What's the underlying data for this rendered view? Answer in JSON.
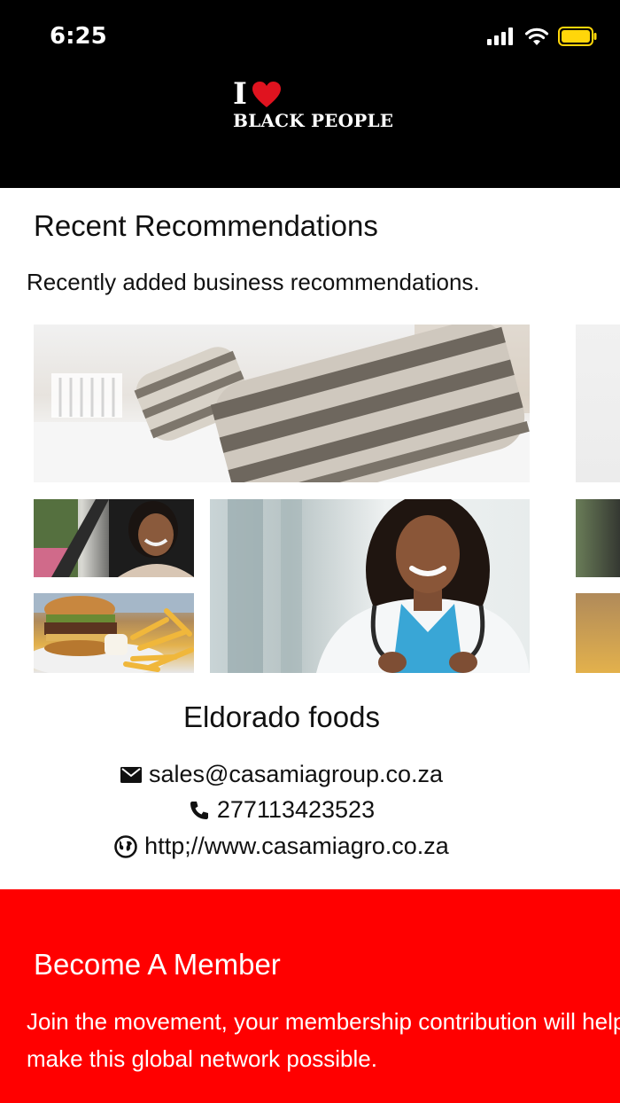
{
  "status_bar": {
    "time": "6:25",
    "icons": [
      "signal-icon",
      "wifi-icon",
      "battery-icon"
    ],
    "battery_color": "#ffd60a"
  },
  "header": {
    "background": "#000000",
    "logo": {
      "line1": "I",
      "heart_icon": "heart-icon",
      "heart_color": "#e0131f",
      "line2": "BLACK PEOPLE"
    }
  },
  "recommendations": {
    "title": "Recent Recommendations",
    "subtitle": "Recently added business recommendations.",
    "card": {
      "images": [
        "bed-pillows-photo",
        "woman-in-car-photo",
        "burger-fries-photo",
        "doctor-photo"
      ],
      "business_name": "Eldorado foods",
      "email": "sales@casamiagroup.co.za",
      "phone": "277113423523",
      "website": "http;//www.casamiagro.co.za"
    }
  },
  "membership": {
    "background": "#ff0000",
    "title": "Become A Member",
    "text": "Join the movement, your membership contribution will help make this global network possible."
  }
}
